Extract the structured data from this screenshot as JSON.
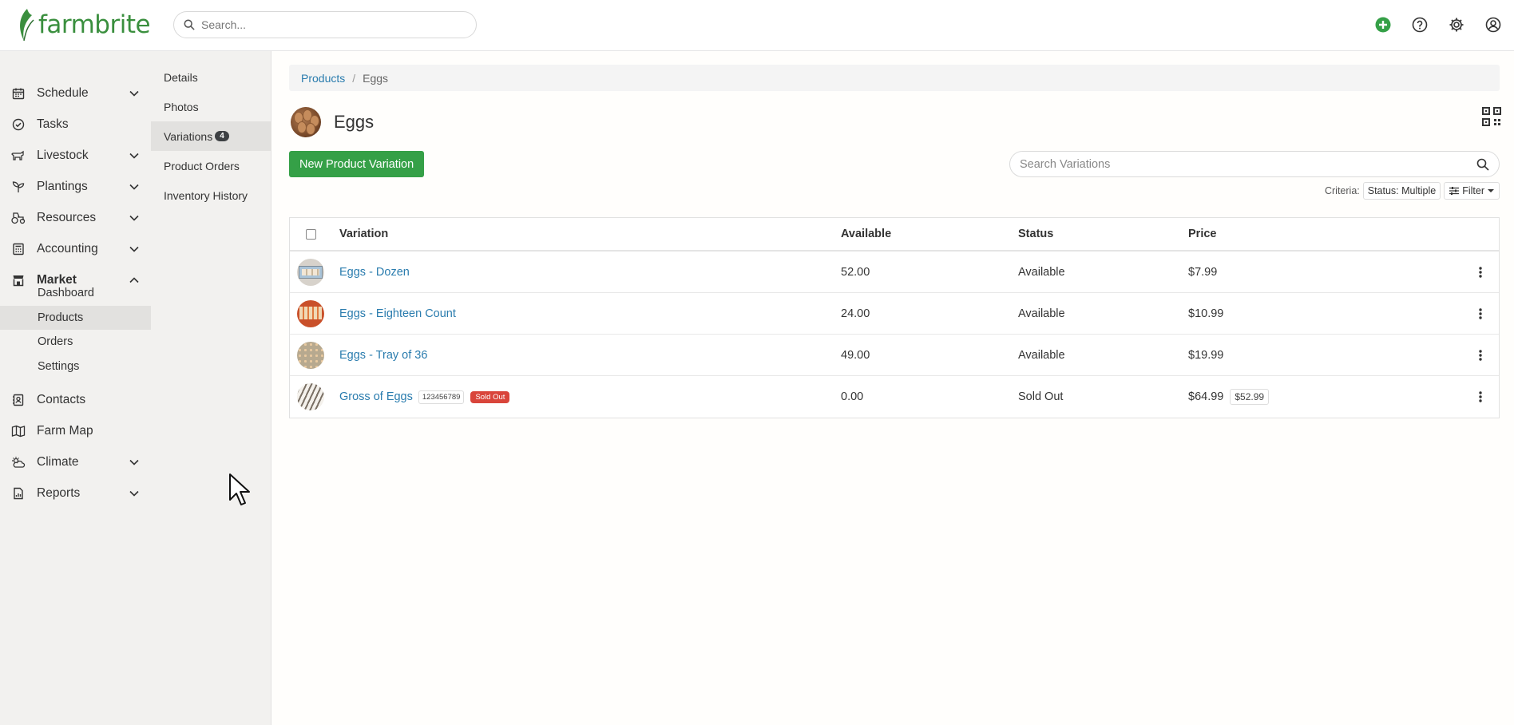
{
  "app": {
    "logo_text": "farmbrite"
  },
  "topbar": {
    "search_placeholder": "Search..."
  },
  "sidebar": {
    "items": [
      {
        "label": "Schedule",
        "icon": "calendar-icon",
        "expandable": true
      },
      {
        "label": "Tasks",
        "icon": "check-circle-icon",
        "expandable": false
      },
      {
        "label": "Livestock",
        "icon": "livestock-icon",
        "expandable": true
      },
      {
        "label": "Plantings",
        "icon": "sprout-icon",
        "expandable": true
      },
      {
        "label": "Resources",
        "icon": "tractor-icon",
        "expandable": true
      },
      {
        "label": "Accounting",
        "icon": "calculator-icon",
        "expandable": true
      },
      {
        "label": "Market",
        "icon": "store-icon",
        "expandable": true,
        "expanded": true
      },
      {
        "label": "Contacts",
        "icon": "contacts-icon",
        "expandable": false
      },
      {
        "label": "Farm Map",
        "icon": "map-icon",
        "expandable": false
      },
      {
        "label": "Climate",
        "icon": "cloud-sun-icon",
        "expandable": true
      },
      {
        "label": "Reports",
        "icon": "report-icon",
        "expandable": true
      }
    ],
    "market_sub": [
      "Dashboard",
      "Products",
      "Orders",
      "Settings"
    ],
    "active_sub": "Products"
  },
  "subnav": {
    "items": [
      "Details",
      "Photos",
      "Variations",
      "Product Orders",
      "Inventory History"
    ],
    "variations_count": "4",
    "active": "Variations"
  },
  "breadcrumb": {
    "parent": "Products",
    "current": "Eggs"
  },
  "product": {
    "title": "Eggs"
  },
  "actions": {
    "new_button": "New Product Variation",
    "search_placeholder": "Search Variations"
  },
  "criteria": {
    "label": "Criteria:",
    "chip": "Status: Multiple",
    "filter": "Filter"
  },
  "table": {
    "headers": {
      "variation": "Variation",
      "available": "Available",
      "status": "Status",
      "price": "Price"
    },
    "rows": [
      {
        "name": "Eggs - Dozen",
        "available": "52.00",
        "status": "Available",
        "price": "$7.99"
      },
      {
        "name": "Eggs - Eighteen Count",
        "available": "24.00",
        "status": "Available",
        "price": "$10.99"
      },
      {
        "name": "Eggs - Tray of 36",
        "available": "49.00",
        "status": "Available",
        "price": "$19.99"
      },
      {
        "name": "Gross of Eggs",
        "sku": "123456789",
        "badge": "Sold Out",
        "available": "0.00",
        "status": "Sold Out",
        "price": "$64.99",
        "price_secondary": "$52.99"
      }
    ]
  },
  "colors": {
    "brand_green": "#3a8f3e",
    "button_green": "#35a047",
    "link_blue": "#2a7cae",
    "sold_out_red": "#d9453b"
  }
}
